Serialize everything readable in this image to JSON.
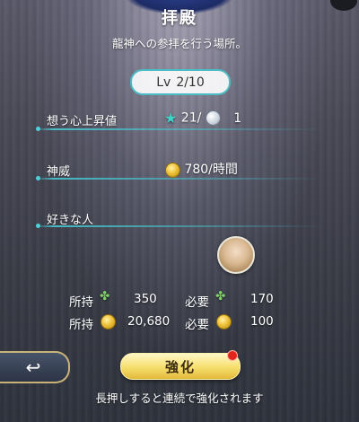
{
  "header": {
    "title": "拝殿",
    "subtitle": "龍神への参拝を行う場所。"
  },
  "level": {
    "prefix": "Lv",
    "value": "2/10"
  },
  "stats": {
    "omoi": {
      "label": "想う心上昇値",
      "value_star": "21/",
      "value_moon": "1"
    },
    "shini": {
      "label": "神威",
      "value": "780/時間"
    },
    "favorite": {
      "label": "好きな人"
    }
  },
  "resources": {
    "row1": {
      "owned_label": "所持",
      "owned_value": "350",
      "need_label": "必要",
      "need_value": "170",
      "icon": "clover-icon"
    },
    "row2": {
      "owned_label": "所持",
      "owned_value": "20,680",
      "need_label": "必要",
      "need_value": "100",
      "icon": "gold-coin-icon"
    }
  },
  "actions": {
    "back_glyph": "↩",
    "upgrade_label": "強化",
    "hint": "長押しすると連続で強化されます"
  },
  "colors": {
    "accent": "#4bbcc4",
    "gold": "#f0c23a",
    "badge": "#e1241c"
  }
}
